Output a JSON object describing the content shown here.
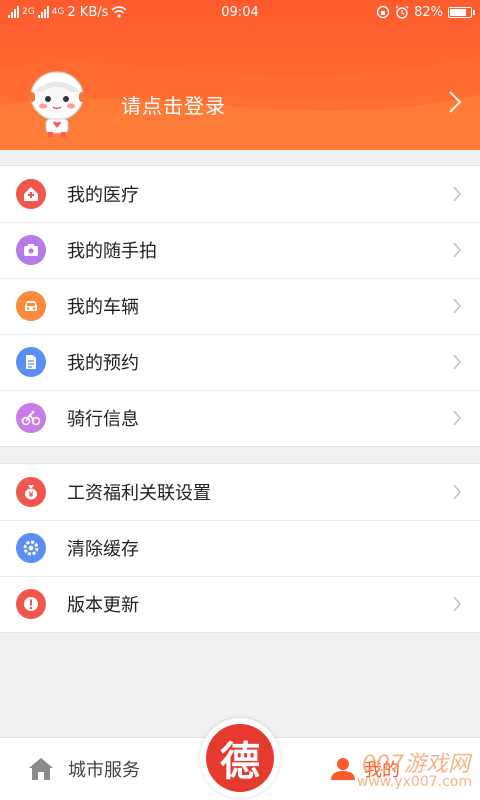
{
  "status_bar": {
    "network_1": "2G",
    "network_2": "4G",
    "speed": "2 KB/s",
    "time": "09:04",
    "battery_percent": "82%",
    "battery_level": 0.82
  },
  "header": {
    "login_prompt": "请点击登录",
    "colors": {
      "gradient_top": "#ff5a2e",
      "gradient_bottom": "#ff7a36"
    }
  },
  "menu_group_1": [
    {
      "label": "我的医疗",
      "icon": "medical-house-icon",
      "color": "#f0564b"
    },
    {
      "label": "我的随手拍",
      "icon": "camera-icon",
      "color": "#b57ce9"
    },
    {
      "label": "我的车辆",
      "icon": "car-icon",
      "color": "#fb8a3c"
    },
    {
      "label": "我的预约",
      "icon": "document-icon",
      "color": "#5a8ef0"
    },
    {
      "label": "骑行信息",
      "icon": "bicycle-icon",
      "color": "#c77ce6"
    }
  ],
  "menu_group_2": [
    {
      "label": "工资福利关联设置",
      "icon": "money-bag-icon",
      "color": "#f0564b"
    },
    {
      "label": "清除缓存",
      "icon": "gear-icon",
      "color": "#5a8ef0"
    },
    {
      "label": "版本更新",
      "icon": "alert-icon",
      "color": "#f0564b"
    }
  ],
  "bottom_nav": {
    "city_services": "城市服务",
    "center_char": "德",
    "my": "我的"
  },
  "watermark": {
    "brand": "007游戏网",
    "url": "www.yx007.com"
  }
}
